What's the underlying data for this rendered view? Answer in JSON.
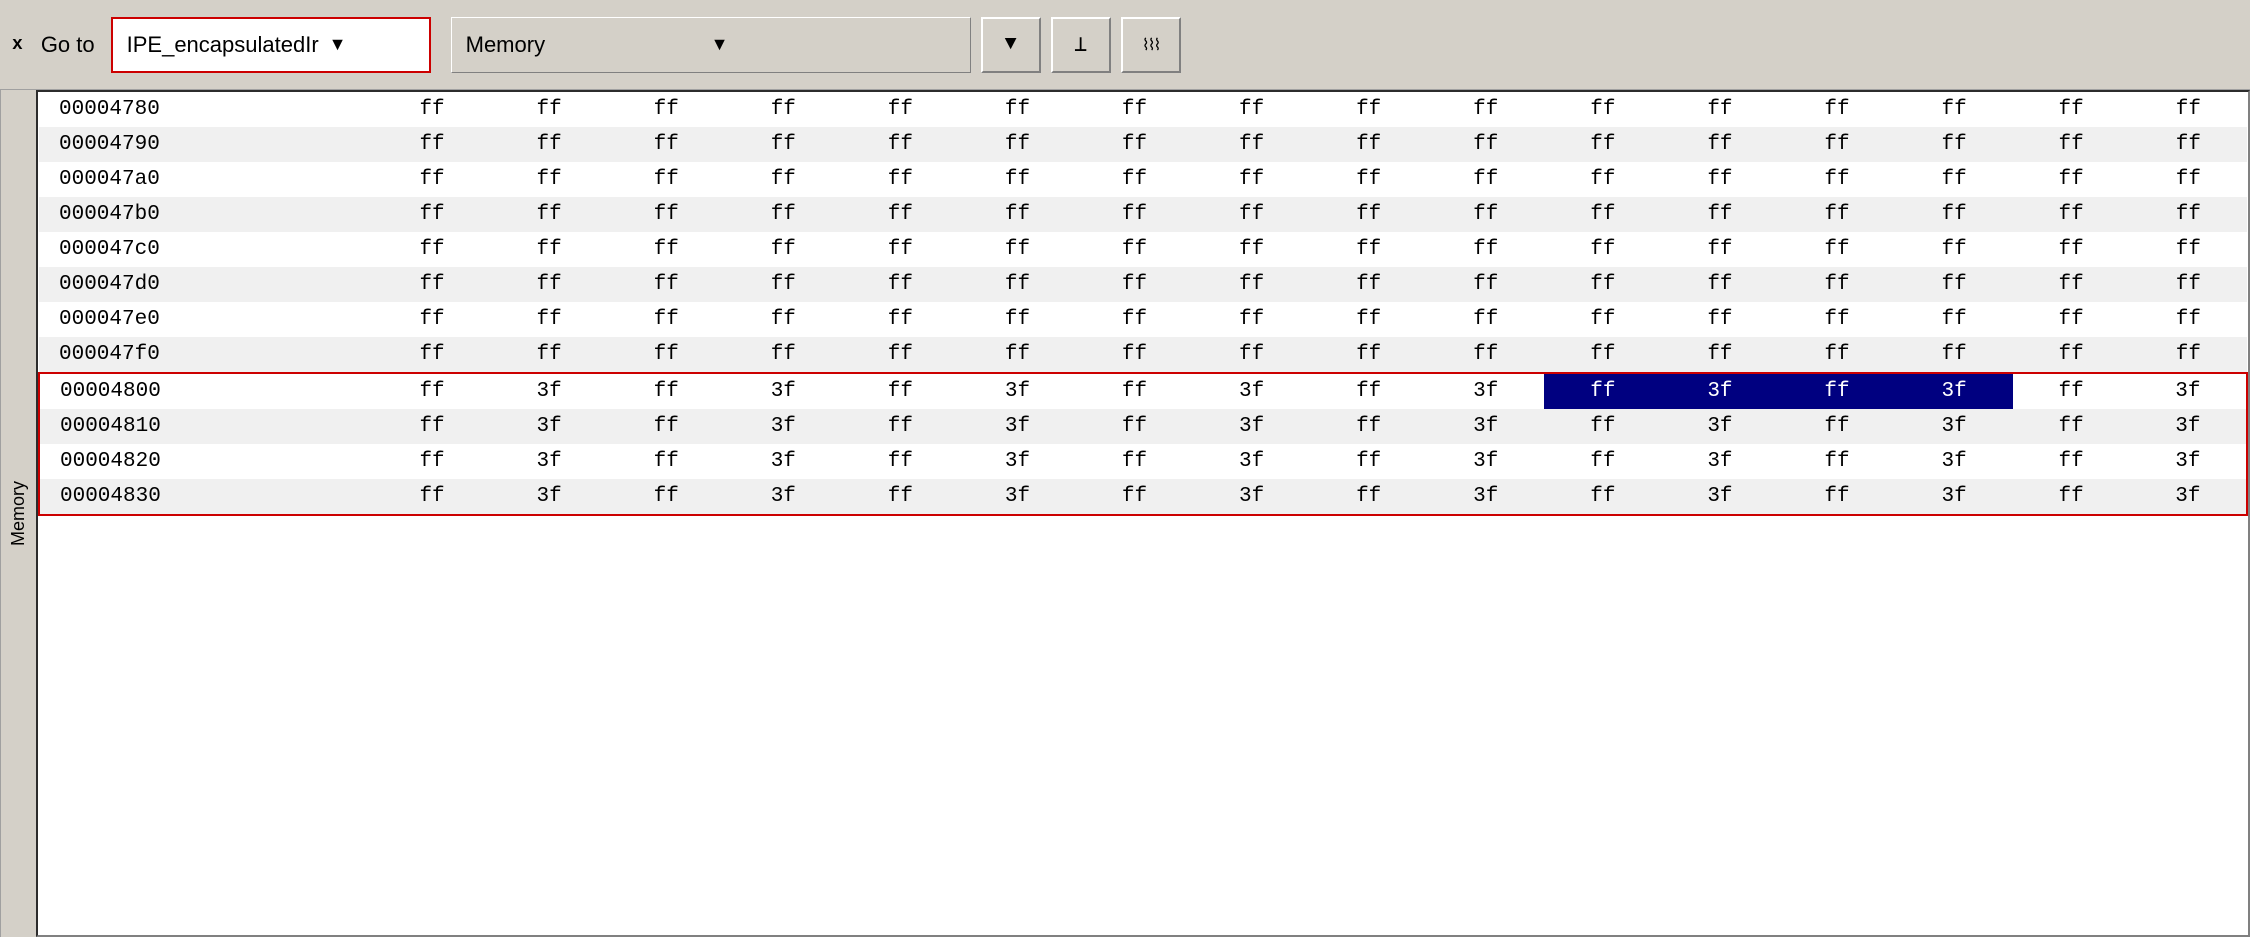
{
  "toolbar": {
    "close_label": "x",
    "goto_label": "Go to",
    "ipe_dropdown_value": "IPE_encapsulatedIr",
    "memory_dropdown_value": "Memory",
    "btn1_icon": "▼",
    "btn2_icon": "⊥",
    "btn3_icon": "⊓⊓⊓"
  },
  "side_label": "Memory",
  "rows": [
    {
      "addr": "00004780",
      "bytes": [
        "ff",
        "ff",
        "ff",
        "ff",
        "ff",
        "ff",
        "ff",
        "ff",
        "ff",
        "ff",
        "ff",
        "ff",
        "ff",
        "ff",
        "ff",
        "ff"
      ],
      "highlight": false,
      "selected": []
    },
    {
      "addr": "00004790",
      "bytes": [
        "ff",
        "ff",
        "ff",
        "ff",
        "ff",
        "ff",
        "ff",
        "ff",
        "ff",
        "ff",
        "ff",
        "ff",
        "ff",
        "ff",
        "ff",
        "ff"
      ],
      "highlight": false,
      "selected": []
    },
    {
      "addr": "000047a0",
      "bytes": [
        "ff",
        "ff",
        "ff",
        "ff",
        "ff",
        "ff",
        "ff",
        "ff",
        "ff",
        "ff",
        "ff",
        "ff",
        "ff",
        "ff",
        "ff",
        "ff"
      ],
      "highlight": false,
      "selected": []
    },
    {
      "addr": "000047b0",
      "bytes": [
        "ff",
        "ff",
        "ff",
        "ff",
        "ff",
        "ff",
        "ff",
        "ff",
        "ff",
        "ff",
        "ff",
        "ff",
        "ff",
        "ff",
        "ff",
        "ff"
      ],
      "highlight": false,
      "selected": []
    },
    {
      "addr": "000047c0",
      "bytes": [
        "ff",
        "ff",
        "ff",
        "ff",
        "ff",
        "ff",
        "ff",
        "ff",
        "ff",
        "ff",
        "ff",
        "ff",
        "ff",
        "ff",
        "ff",
        "ff"
      ],
      "highlight": false,
      "selected": []
    },
    {
      "addr": "000047d0",
      "bytes": [
        "ff",
        "ff",
        "ff",
        "ff",
        "ff",
        "ff",
        "ff",
        "ff",
        "ff",
        "ff",
        "ff",
        "ff",
        "ff",
        "ff",
        "ff",
        "ff"
      ],
      "highlight": false,
      "selected": []
    },
    {
      "addr": "000047e0",
      "bytes": [
        "ff",
        "ff",
        "ff",
        "ff",
        "ff",
        "ff",
        "ff",
        "ff",
        "ff",
        "ff",
        "ff",
        "ff",
        "ff",
        "ff",
        "ff",
        "ff"
      ],
      "highlight": false,
      "selected": []
    },
    {
      "addr": "000047f0",
      "bytes": [
        "ff",
        "ff",
        "ff",
        "ff",
        "ff",
        "ff",
        "ff",
        "ff",
        "ff",
        "ff",
        "ff",
        "ff",
        "ff",
        "ff",
        "ff",
        "ff"
      ],
      "highlight": false,
      "selected": []
    },
    {
      "addr": "00004800",
      "bytes": [
        "ff",
        "3f",
        "ff",
        "3f",
        "ff",
        "3f",
        "ff",
        "3f",
        "ff",
        "3f",
        "ff",
        "3f",
        "ff",
        "3f",
        "ff",
        "3f"
      ],
      "highlight": true,
      "top_border": true,
      "selected": [
        10,
        11,
        12,
        13
      ]
    },
    {
      "addr": "00004810",
      "bytes": [
        "ff",
        "3f",
        "ff",
        "3f",
        "ff",
        "3f",
        "ff",
        "3f",
        "ff",
        "3f",
        "ff",
        "3f",
        "ff",
        "3f",
        "ff",
        "3f"
      ],
      "highlight": true,
      "selected": []
    },
    {
      "addr": "00004820",
      "bytes": [
        "ff",
        "3f",
        "ff",
        "3f",
        "ff",
        "3f",
        "ff",
        "3f",
        "ff",
        "3f",
        "ff",
        "3f",
        "ff",
        "3f",
        "ff",
        "3f"
      ],
      "highlight": true,
      "selected": []
    },
    {
      "addr": "00004830",
      "bytes": [
        "ff",
        "3f",
        "ff",
        "3f",
        "ff",
        "3f",
        "ff",
        "3f",
        "ff",
        "3f",
        "ff",
        "3f",
        "ff",
        "3f",
        "ff",
        "3f"
      ],
      "highlight": true,
      "bottom_partial": true,
      "selected": []
    }
  ]
}
